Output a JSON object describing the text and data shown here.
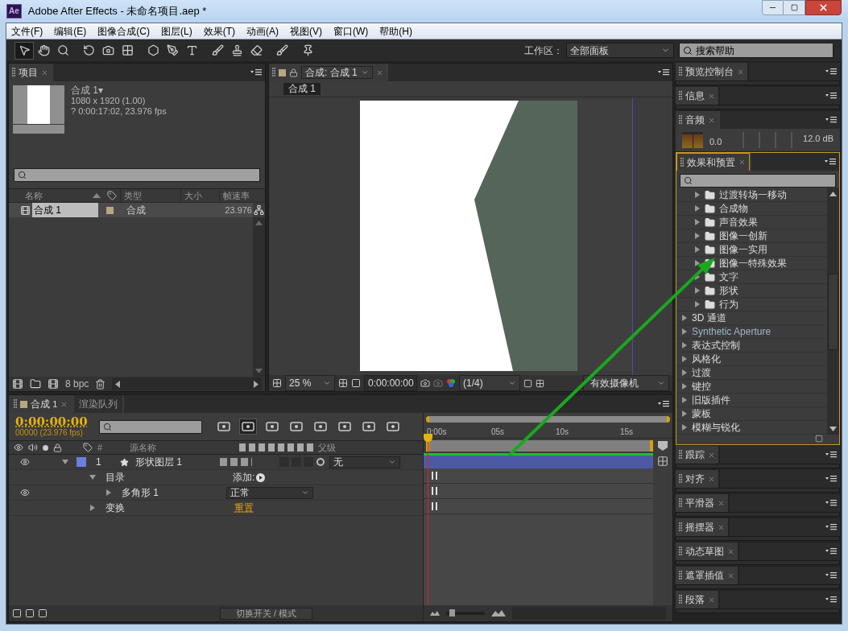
{
  "window": {
    "title": "Adobe After Effects - 未命名项目.aep *",
    "app_badge": "Ae"
  },
  "menu": [
    "文件(F)",
    "编辑(E)",
    "图像合成(C)",
    "图层(L)",
    "效果(T)",
    "动画(A)",
    "视图(V)",
    "窗口(W)",
    "帮助(H)"
  ],
  "toolbar": {
    "workspace_label": "工作区：",
    "workspace": "全部面板",
    "help_search": "搜索帮助"
  },
  "project": {
    "tab": "项目",
    "comp_name": "合成",
    "comp_number": "1",
    "comp_menu": "▾",
    "dims": "1080 x 1920 (1.00)",
    "duration": "? 0:00:17:02, 23.976 fps",
    "columns": [
      "名称",
      "类型",
      "大小",
      "帧速率"
    ],
    "rows": [
      {
        "name": "合成",
        "number": "1",
        "type": "合成",
        "fps": "23.976",
        "selected": true
      }
    ],
    "bpc": "8 bpc"
  },
  "viewer": {
    "tab": "合成: 合成 1",
    "breadcrumb": "合成 1",
    "zoom": "25 %",
    "timecode": "0:00:00:00",
    "resolution": "(1/4)",
    "camera": "有效摄像机"
  },
  "right_panels": [
    {
      "kind": "collapsed",
      "title": "预览控制台"
    },
    {
      "kind": "collapsed",
      "title": "信息"
    },
    {
      "kind": "audio",
      "title": "音频",
      "level": "0.0",
      "db": "12.0 dB"
    },
    {
      "kind": "effects",
      "title": "效果和预置",
      "items": [
        {
          "kind": "folder",
          "label": "过渡转场一移动"
        },
        {
          "kind": "folder",
          "label": "合成物"
        },
        {
          "kind": "folder",
          "label": "声音效果"
        },
        {
          "kind": "folder",
          "label": "图像一创新"
        },
        {
          "kind": "folder",
          "label": "图像一实用"
        },
        {
          "kind": "folder",
          "label": "图像一特殊效果"
        },
        {
          "kind": "folder",
          "label": "文字"
        },
        {
          "kind": "folder",
          "label": "形状"
        },
        {
          "kind": "folder",
          "label": "行为"
        },
        {
          "kind": "category",
          "label": "3D 通道"
        },
        {
          "kind": "category",
          "label": "Synthetic Aperture",
          "accent": true
        },
        {
          "kind": "category",
          "label": "表达式控制"
        },
        {
          "kind": "category",
          "label": "风格化"
        },
        {
          "kind": "category",
          "label": "过渡"
        },
        {
          "kind": "category",
          "label": "键控"
        },
        {
          "kind": "category",
          "label": "旧版插件"
        },
        {
          "kind": "category",
          "label": "蒙板"
        },
        {
          "kind": "category",
          "label": "模糊与锐化"
        }
      ]
    },
    {
      "kind": "collapsed",
      "title": "跟踪"
    },
    {
      "kind": "collapsed",
      "title": "对齐"
    },
    {
      "kind": "collapsed",
      "title": "平滑器"
    },
    {
      "kind": "collapsed",
      "title": "摇摆器"
    },
    {
      "kind": "collapsed",
      "title": "动态草图"
    },
    {
      "kind": "collapsed",
      "title": "遮罩插值"
    },
    {
      "kind": "collapsed",
      "title": "段落"
    }
  ],
  "timeline": {
    "tabs": [
      {
        "label": "合成",
        "number": "1",
        "selected": true
      },
      {
        "label": "渲染队列",
        "selected": false
      }
    ],
    "timecode": "0:00:00:00",
    "frame_info": "00000 (23.976 fps)",
    "columns": {
      "number": "#",
      "source": "源名称",
      "parent": "父级"
    },
    "layers": [
      {
        "number": "1",
        "name": "形状图层 1",
        "color": "#6b7fe0",
        "parent": "无",
        "expanded": true,
        "children": [
          {
            "label": "目录",
            "expanded": true,
            "action": "添加:",
            "children": [
              {
                "label": "多角形 1",
                "mode": "正常",
                "expanded": false
              }
            ]
          },
          {
            "label": "变换",
            "link": "重置",
            "expanded": false
          }
        ]
      }
    ],
    "ruler": [
      "0:00s",
      "05s",
      "10s",
      "15s"
    ],
    "zoom_slider": {
      "level": 0.1
    },
    "toggle_button": "切换开关 / 模式"
  }
}
